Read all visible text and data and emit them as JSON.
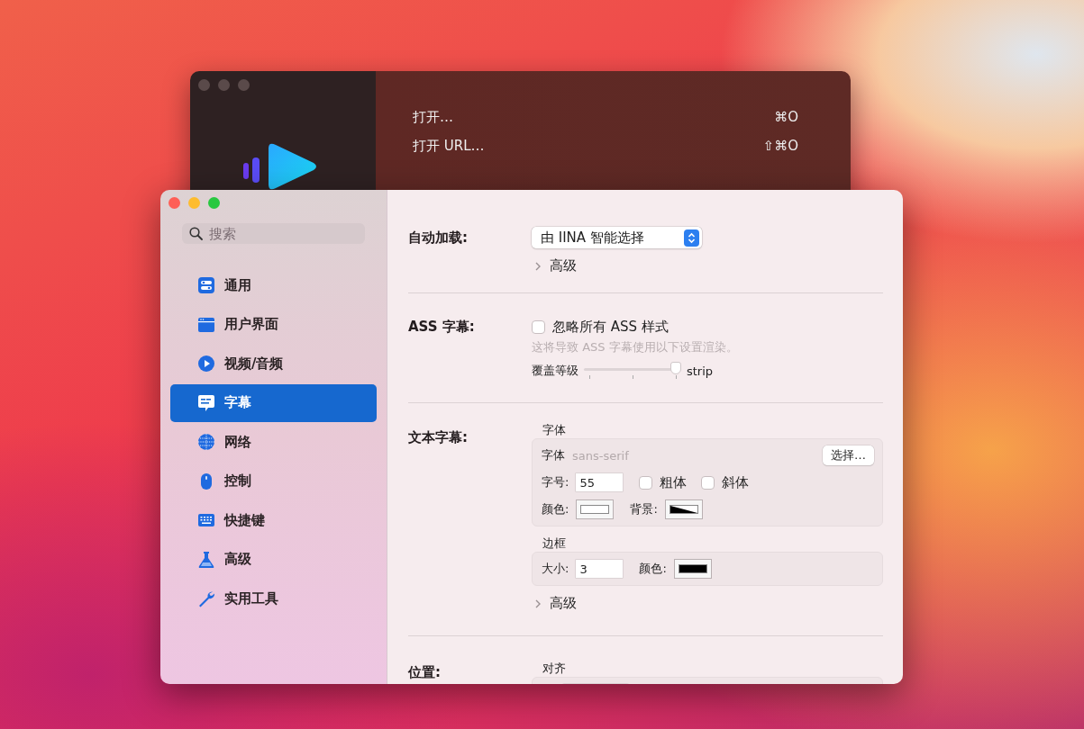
{
  "back_window": {
    "menu_items": [
      {
        "label": "打开…",
        "shortcut": "⌘O"
      },
      {
        "label": "打开 URL…",
        "shortcut": "⇧⌘O"
      }
    ]
  },
  "window": {
    "search": {
      "placeholder": "搜索"
    },
    "sidebar": {
      "items": [
        {
          "label": "通用",
          "selected": false
        },
        {
          "label": "用户界面",
          "selected": false
        },
        {
          "label": "视频/音频",
          "selected": false
        },
        {
          "label": "字幕",
          "selected": true
        },
        {
          "label": "网络",
          "selected": false
        },
        {
          "label": "控制",
          "selected": false
        },
        {
          "label": "快捷键",
          "selected": false
        },
        {
          "label": "高级",
          "selected": false
        },
        {
          "label": "实用工具",
          "selected": false
        }
      ]
    }
  },
  "auto_load": {
    "label": "自动加载:",
    "popup": "由 IINA 智能选择",
    "disclosure": {
      "label": "高级",
      "expanded": false
    }
  },
  "ass": {
    "label": "ASS 字幕:",
    "checkbox": {
      "label": "忽略所有 ASS 样式",
      "checked": false
    },
    "note": "这将导致 ASS 字幕使用以下设置渲染。",
    "slider": {
      "label": "覆盖等级",
      "level": 1,
      "reading": "strip"
    }
  },
  "text_subs": {
    "label": "文本字幕:",
    "font_group": {
      "title": "字体",
      "font_label": "字体",
      "font_value": "sans-serif",
      "choose_button": "选择…",
      "size_label": "字号:",
      "size_value": "55",
      "bold": {
        "label": "粗体",
        "checked": false
      },
      "italic": {
        "label": "斜体",
        "checked": false
      },
      "color_label": "颜色:",
      "color": "#ffffff",
      "background_label": "背景:",
      "background": {
        "color": "#000000"
      }
    },
    "border_group": {
      "title": "边框",
      "size_label": "大小:",
      "size_value": "3",
      "color_label": "颜色:",
      "color": "#000000"
    },
    "disclosure": {
      "label": "高级",
      "expanded": false
    }
  },
  "position": {
    "label": "位置:",
    "group": {
      "title": "对齐"
    }
  }
}
